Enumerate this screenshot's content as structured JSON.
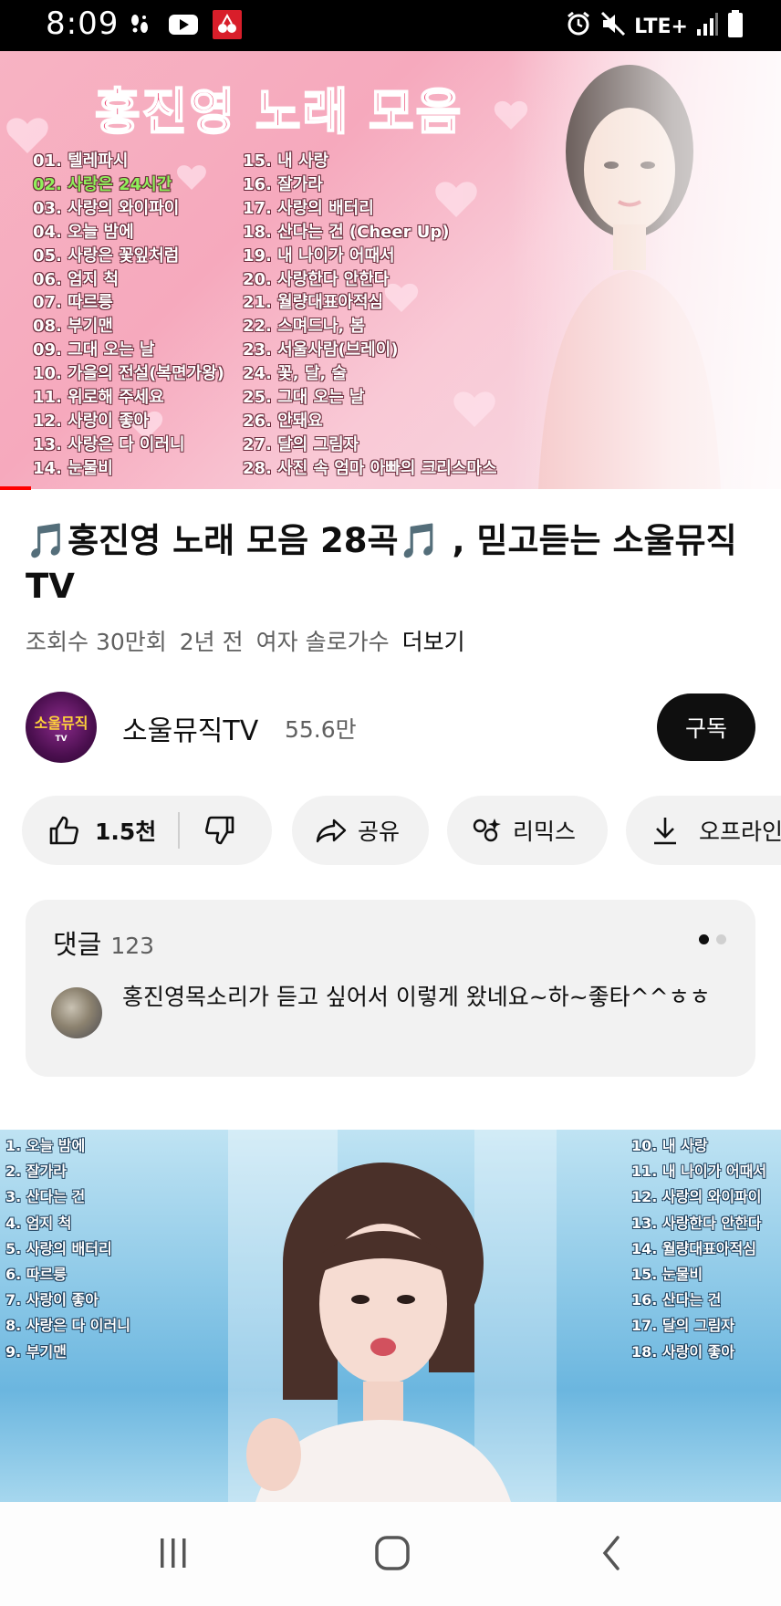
{
  "status_bar": {
    "time": "8:09",
    "network": "LTE+",
    "left_icons": [
      "footsteps-icon",
      "youtube-icon",
      "app-icon"
    ],
    "right_icons": [
      "alarm-icon",
      "mute-icon",
      "signal-icon",
      "battery-icon"
    ]
  },
  "thumbnail1": {
    "title": "홍진영 노래 모음",
    "songs_col1": [
      "01. 텔레파시",
      "02. 사랑은 24시간",
      "03. 사랑의 와이파이",
      "04. 오늘 밤에",
      "05. 사랑은 꽃잎처럼",
      "06. 엄지 척",
      "07. 따르릉",
      "08. 부기맨",
      "09. 그대 오는 날",
      "10. 가을의 전설(복면가왕)",
      "11. 위로해 주세요",
      "12. 사랑이 좋아",
      "13. 사랑은 다 이러니",
      "14. 눈물비"
    ],
    "songs_col2": [
      "15. 내 사랑",
      "16. 잘가라",
      "17. 사랑의 배터리",
      "18. 산다는 건 (Cheer Up)",
      "19. 내 나이가 어때서",
      "20. 사랑한다 안한다",
      "21. 월량대표아적심",
      "22. 스며드나, 봄",
      "23. 서울사람(브레이)",
      "24. 꽃, 달, 술",
      "25. 그대 오는 날",
      "26. 안돼요",
      "27. 달의 그림자",
      "28. 사진 속 엄마 아빠의 크리스마스"
    ],
    "highlight_index": 1,
    "highlight_color": "#8ff05a",
    "playback_progress": 0.04
  },
  "video": {
    "title": "🎵홍진영 노래 모음 28곡🎵 , 믿고듣는 소울뮤직TV",
    "views": "조회수 30만회",
    "age": "2년 전",
    "tag": "여자 솔로가수",
    "more": "더보기"
  },
  "channel": {
    "name": "소울뮤직TV",
    "subscribers": "55.6만",
    "avatar_text": "소울뮤직",
    "avatar_small": "TV",
    "subscribe_label": "구독"
  },
  "actions": {
    "like_count": "1.5천",
    "share": "공유",
    "remix": "리믹스",
    "offline": "오프라인"
  },
  "comments": {
    "label": "댓글",
    "count": "123",
    "preview_text": "홍진영목소리가 듣고 싶어서 이렇게 왔네요~하~좋타^^ㅎㅎ"
  },
  "thumbnail2": {
    "songs_col1": [
      "1. 오늘 밤에",
      "2. 잘가라",
      "3. 산다는 건",
      "4. 엄지 척",
      "5. 사랑의 배터리",
      "6. 따르릉",
      "7. 사랑이 좋아",
      "8. 사랑은 다 이러니",
      "9. 부기맨"
    ],
    "songs_col2": [
      "10. 내 사랑",
      "11. 내 나이가 어때서",
      "12. 사랑의 와이파이",
      "13. 사랑한다 안한다",
      "14. 월량대표아적심",
      "15. 눈물비",
      "16. 산다는 건",
      "17. 달의 그림자",
      "18. 사랑이 좋아"
    ]
  },
  "colors": {
    "accent_red": "#ff0000",
    "subscribe_bg": "#0f0f0f",
    "chip_bg": "#f2f2f2",
    "secondary_text": "#606060"
  }
}
